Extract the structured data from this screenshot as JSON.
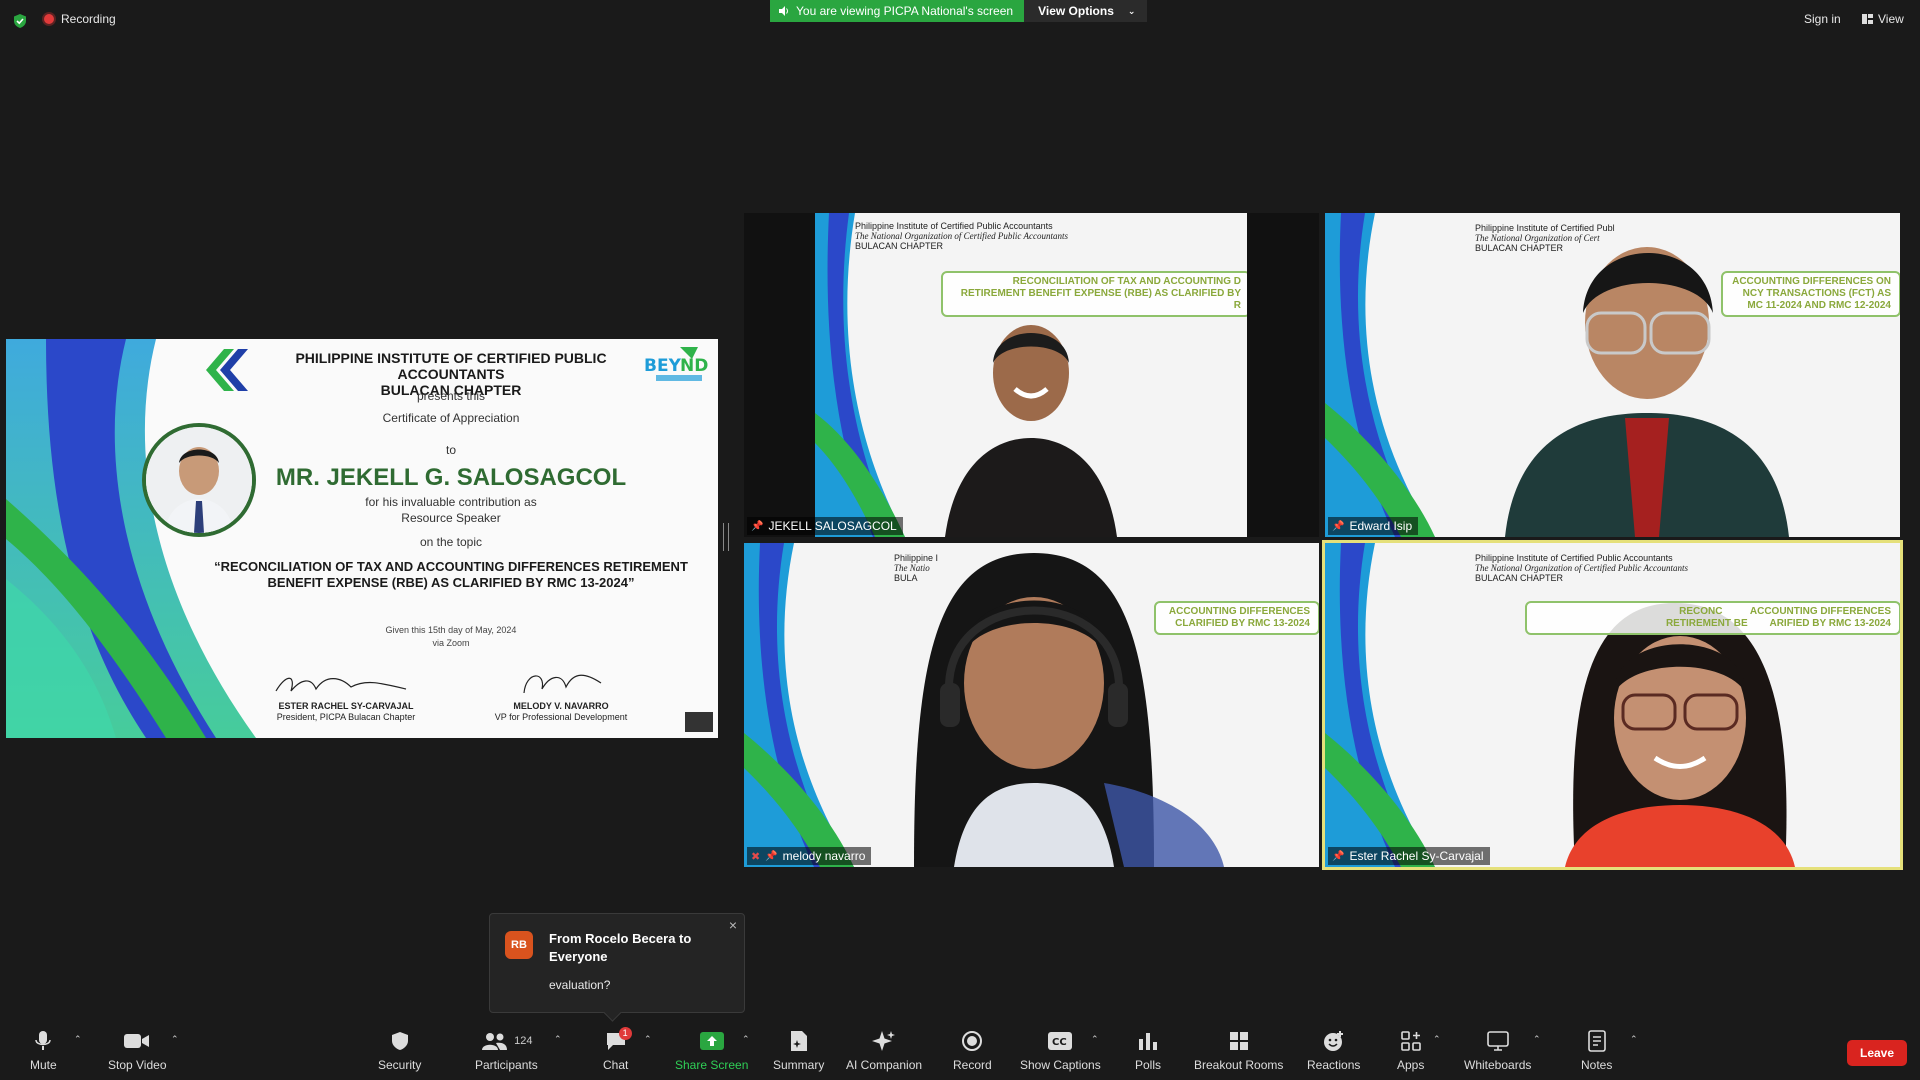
{
  "topbar": {
    "recording_label": "Recording",
    "banner_text": "You are viewing PICPA National's screen",
    "view_options_label": "View Options",
    "sign_in_label": "Sign in",
    "view_label": "View"
  },
  "certificate": {
    "org_line1": "PHILIPPINE INSTITUTE OF CERTIFIED PUBLIC ACCOUNTANTS",
    "org_line2": "BULACAN CHAPTER",
    "presents": "presents this",
    "cert_title": "Certificate of Appreciation",
    "to": "to",
    "recipient": "MR. JEKELL G. SALOSAGCOL",
    "contribution1": "for his invaluable contribution as",
    "contribution2": "Resource Speaker",
    "on_topic": "on the topic",
    "topic_line1": "“RECONCILIATION OF TAX AND ACCOUNTING DIFFERENCES RETIREMENT",
    "topic_line2": "BENEFIT EXPENSE (RBE) AS CLARIFIED BY RMC 13-2024”",
    "given": "Given this 15th day of May, 2024",
    "via": "via Zoom",
    "sig1_name": "ESTER RACHEL SY-CARVAJAL",
    "sig1_title": "President, PICPA Bulacan Chapter",
    "sig2_name": "MELODY V. NAVARRO",
    "sig2_title": "VP for Professional Development"
  },
  "tiles": [
    {
      "name": "JEKELL SALOSAGCOL",
      "hdr1": "Philippine Institute of Certified Public Accountants",
      "hdr2": "The National Organization of Certified Public Accountants",
      "hdr3": "BULACAN CHAPTER",
      "banner1": "RECONCILIATION OF TAX AND ACCOUNTING D",
      "banner2": "RETIREMENT BENEFIT EXPENSE (RBE) AS CLARIFIED BY R"
    },
    {
      "name": "Edward Isip",
      "hdr1": "Philippine Institute of Certified Publ",
      "hdr2": "The National Organization of Cert",
      "hdr3": "BULACAN CHAPTER",
      "banner1": "ACCOUNTING DIFFERENCES ON",
      "banner2": "NCY TRANSACTIONS (FCT) AS",
      "banner3": "MC 11-2024 AND RMC 12-2024"
    },
    {
      "name": "melody navarro",
      "hdr1": "Philippine I",
      "hdr2": "The Natio",
      "hdr3": "BULA",
      "banner1": "ACCOUNTING DIFFERENCES",
      "banner2": "CLARIFIED BY RMC 13-2024"
    },
    {
      "name": "Ester Rachel Sy-Carvajal",
      "hdr1": "Philippine Institute of Certified Public Accountants",
      "hdr2": "The National Organization of Certified Public Accountants",
      "hdr3": "BULACAN CHAPTER",
      "banner1": "RECONC          ACCOUNTING DIFFERENCES",
      "banner2": "RETIREMENT BE        ARIFIED BY RMC 13-2024"
    }
  ],
  "chat_toast": {
    "initials": "RB",
    "from": "From Rocelo Becera to Everyone",
    "message": "evaluation?",
    "close": "×"
  },
  "toolbar": {
    "mute": "Mute",
    "stop_video": "Stop Video",
    "security": "Security",
    "participants": "Participants",
    "participants_count": "124",
    "chat": "Chat",
    "chat_badge": "1",
    "share_screen": "Share Screen",
    "summary": "Summary",
    "ai_companion": "AI Companion",
    "record": "Record",
    "show_captions": "Show Captions",
    "polls": "Polls",
    "breakout_rooms": "Breakout Rooms",
    "reactions": "Reactions",
    "apps": "Apps",
    "whiteboards": "Whiteboards",
    "notes": "Notes",
    "leave": "Leave"
  },
  "colors": {
    "accent_green": "#2aa640",
    "leave_red": "#d9241f",
    "active_speaker": "#e5e07a",
    "cert_green": "#2f6b32"
  }
}
